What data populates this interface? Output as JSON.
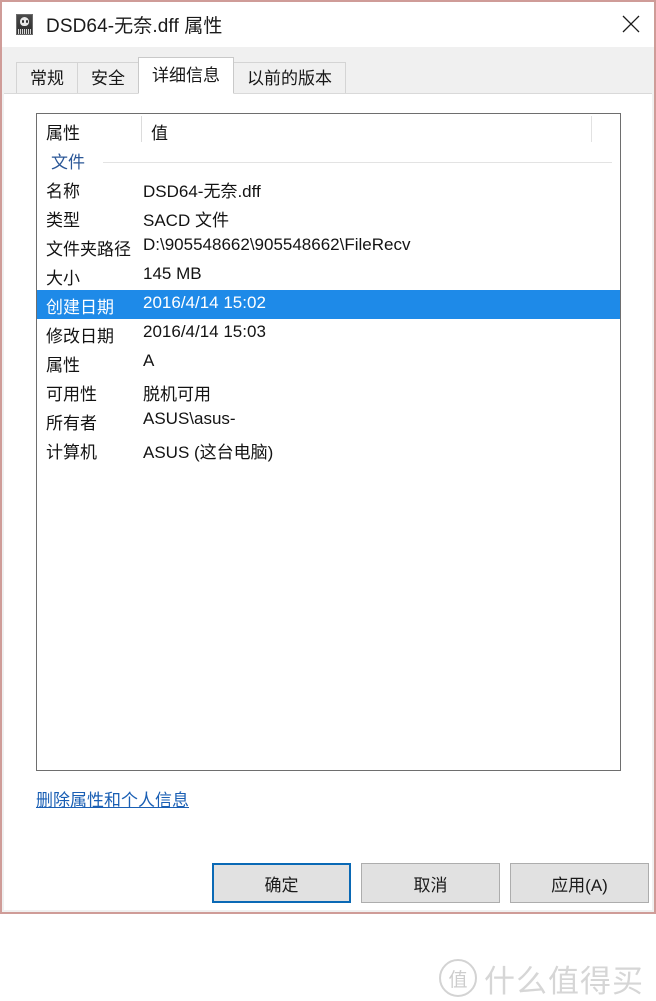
{
  "window": {
    "title": "DSD64-无奈.dff 属性",
    "icon": "media-file-icon",
    "close_icon": "close-icon"
  },
  "tabs": [
    {
      "label": "常规",
      "active": false
    },
    {
      "label": "安全",
      "active": false
    },
    {
      "label": "详细信息",
      "active": true
    },
    {
      "label": "以前的版本",
      "active": false
    }
  ],
  "list": {
    "columns": {
      "property": "属性",
      "value": "值"
    },
    "section": "文件",
    "rows": [
      {
        "label": "名称",
        "value": "DSD64-无奈.dff",
        "selected": false
      },
      {
        "label": "类型",
        "value": "SACD 文件",
        "selected": false
      },
      {
        "label": "文件夹路径",
        "value": "D:\\905548662\\905548662\\FileRecv",
        "selected": false
      },
      {
        "label": "大小",
        "value": "145 MB",
        "selected": false
      },
      {
        "label": "创建日期",
        "value": "2016/4/14 15:02",
        "selected": true
      },
      {
        "label": "修改日期",
        "value": "2016/4/14 15:03",
        "selected": false
      },
      {
        "label": "属性",
        "value": "A",
        "selected": false
      },
      {
        "label": "可用性",
        "value": "脱机可用",
        "selected": false
      },
      {
        "label": "所有者",
        "value": "ASUS\\asus-",
        "selected": false
      },
      {
        "label": "计算机",
        "value": "ASUS (这台电脑)",
        "selected": false
      }
    ]
  },
  "remove_link": "删除属性和个人信息",
  "buttons": {
    "ok": "确定",
    "cancel": "取消",
    "apply": "应用(A)"
  },
  "watermark": {
    "badge": "值",
    "text": "什么值得买"
  },
  "colors": {
    "selection": "#1e8ae8",
    "link": "#1a5fb4",
    "section_header": "#2b5797",
    "default_button_border": "#0a69b5",
    "window_border": "#cf9c98"
  }
}
